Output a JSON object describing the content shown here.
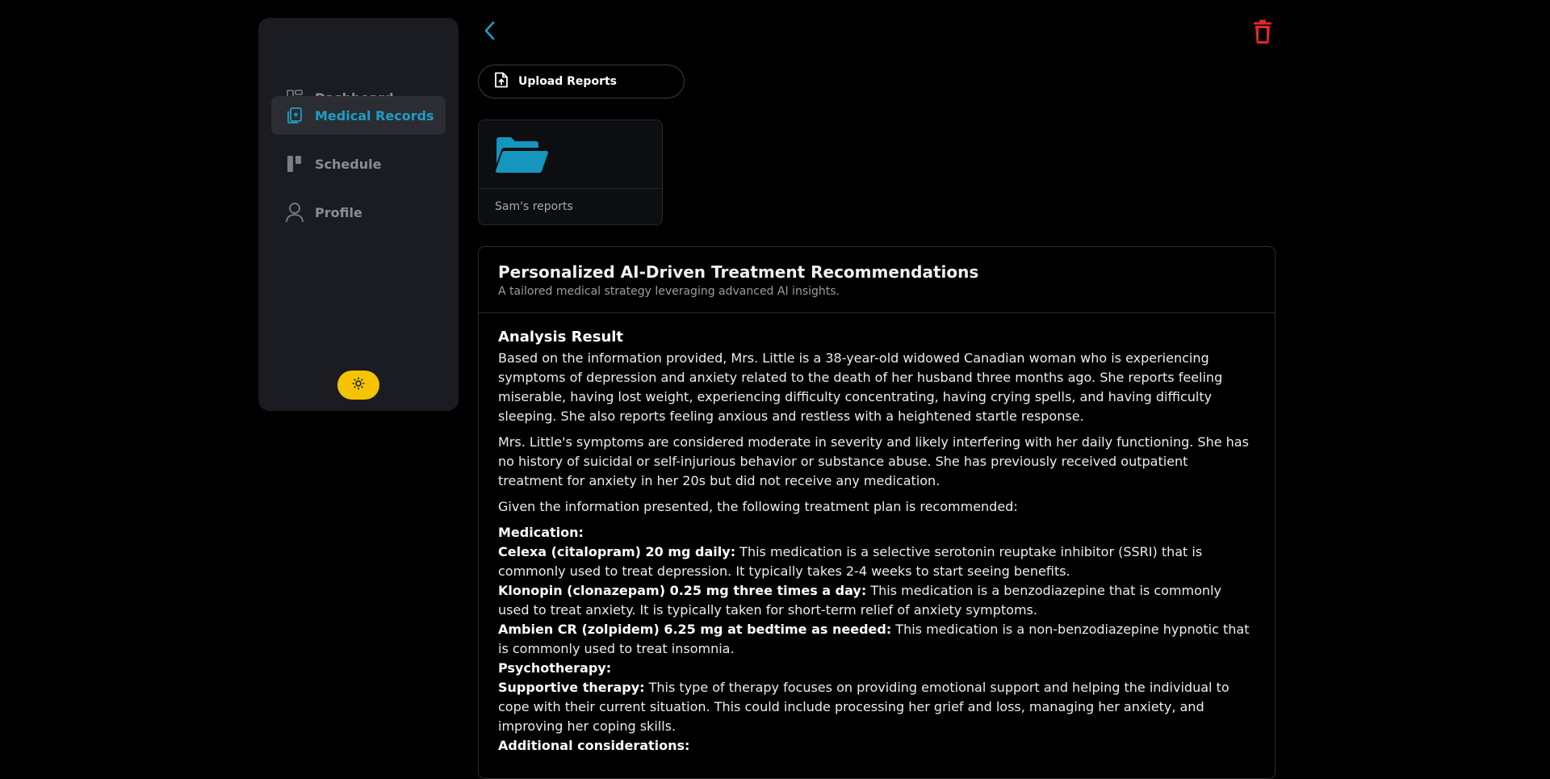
{
  "sidebar": {
    "items": [
      {
        "label": "Dashboard",
        "icon": "dashboard-icon",
        "active": false
      },
      {
        "label": "Medical Records",
        "icon": "medical-records-icon",
        "active": true
      },
      {
        "label": "Schedule",
        "icon": "schedule-icon",
        "active": false
      },
      {
        "label": "Profile",
        "icon": "profile-icon",
        "active": false
      }
    ],
    "theme_toggle_icon": "sun-icon"
  },
  "toolbar": {
    "back_icon": "chevron-left-icon",
    "delete_icon": "trash-icon"
  },
  "upload": {
    "label": "Upload Reports",
    "icon": "file-upload-icon"
  },
  "folders": [
    {
      "name": "Sam's reports",
      "icon": "folder-open-icon"
    }
  ],
  "colors": {
    "accent": "#1e9ec4",
    "danger": "#e0262b",
    "toggle": "#f5c400",
    "background": "#000000",
    "sidebar": "#1b1c21"
  },
  "recommendations": {
    "title": "Personalized AI-Driven Treatment Recommendations",
    "subtitle": "A tailored medical strategy leveraging advanced AI insights.",
    "analysis_heading": "Analysis Result",
    "paragraphs": [
      "Based on the information provided, Mrs. Little is a 38-year-old widowed Canadian woman who is experiencing symptoms of depression and anxiety related to the death of her husband three months ago. She reports feeling miserable, having lost weight, experiencing difficulty concentrating, having crying spells, and having difficulty sleeping. She also reports feeling anxious and restless with a heightened startle response.",
      "Mrs. Little's symptoms are considered moderate in severity and likely interfering with her daily functioning. She has no history of suicidal or self-injurious behavior or substance abuse. She has previously received outpatient treatment for anxiety in her 20s but did not receive any medication.",
      "Given the information presented, the following treatment plan is recommended:"
    ],
    "medication_heading": "Medication:",
    "medications": [
      {
        "name": "Celexa (citalopram) 20 mg daily:",
        "text": " This medication is a selective serotonin reuptake inhibitor (SSRI) that is commonly used to treat depression. It typically takes 2-4 weeks to start seeing benefits."
      },
      {
        "name": "Klonopin (clonazepam) 0.25 mg three times a day:",
        "text": " This medication is a benzodiazepine that is commonly used to treat anxiety. It is typically taken for short-term relief of anxiety symptoms."
      },
      {
        "name": "Ambien CR (zolpidem) 6.25 mg at bedtime as needed:",
        "text": " This medication is a non-benzodiazepine hypnotic that is commonly used to treat insomnia."
      }
    ],
    "psychotherapy_heading": "Psychotherapy:",
    "therapies": [
      {
        "name": "Supportive therapy:",
        "text": " This type of therapy focuses on providing emotional support and helping the individual to cope with their current situation. This could include processing her grief and loss, managing her anxiety, and improving her coping skills."
      }
    ],
    "additional_heading": "Additional considerations:"
  }
}
